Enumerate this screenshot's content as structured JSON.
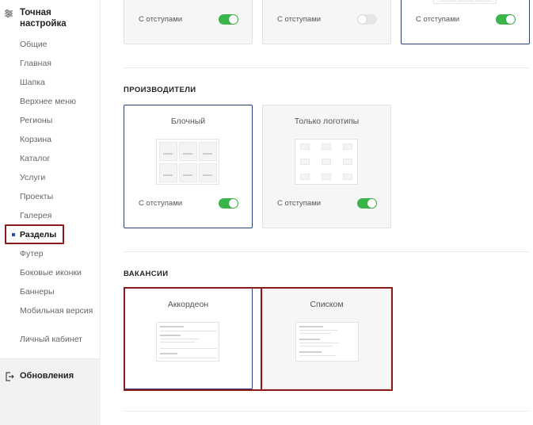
{
  "sidebar": {
    "title": "Точная настройка",
    "items": [
      {
        "label": "Общие"
      },
      {
        "label": "Главная"
      },
      {
        "label": "Шапка"
      },
      {
        "label": "Верхнее меню"
      },
      {
        "label": "Регионы"
      },
      {
        "label": "Корзина"
      },
      {
        "label": "Каталог"
      },
      {
        "label": "Услуги"
      },
      {
        "label": "Проекты"
      },
      {
        "label": "Галерея"
      },
      {
        "label": "Разделы"
      },
      {
        "label": "Футер"
      },
      {
        "label": "Боковые иконки"
      },
      {
        "label": "Баннеры"
      },
      {
        "label": "Мобильная версия"
      },
      {
        "label": "Личный кабинет"
      }
    ],
    "active_item": "Разделы",
    "updates_label": "Обновления"
  },
  "top_row": {
    "cards": [
      {
        "toggle_label": "С отступами",
        "toggle_on": true
      },
      {
        "toggle_label": "С отступами",
        "toggle_on": false
      },
      {
        "toggle_label": "С отступами",
        "toggle_on": true
      }
    ]
  },
  "manufacturers": {
    "title": "ПРОИЗВОДИТЕЛИ",
    "cards": [
      {
        "title": "Блочный",
        "toggle_label": "С отступами",
        "toggle_on": true,
        "selected": true
      },
      {
        "title": "Только логотипы",
        "toggle_label": "С отступами",
        "toggle_on": true,
        "selected": false
      }
    ]
  },
  "vacancies": {
    "title": "ВАКАНСИИ",
    "cards": [
      {
        "title": "Аккордеон",
        "selected": true
      },
      {
        "title": "Списком",
        "selected": false
      }
    ]
  },
  "colors": {
    "accent_green": "#3bb44a",
    "selected_border": "#2b3f7a",
    "highlight_red": "#8b1a1a"
  },
  "icons": {
    "settings": "sliders-icon",
    "updates": "exit-icon"
  }
}
